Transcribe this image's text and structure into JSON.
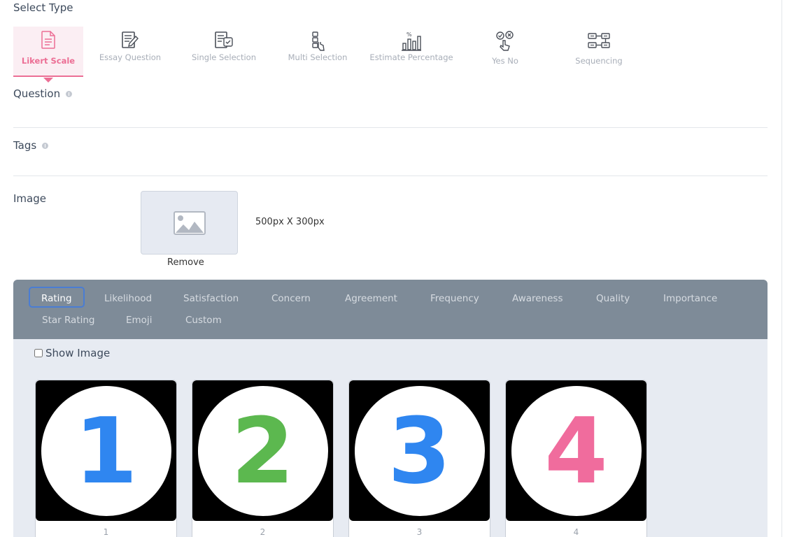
{
  "select_type": {
    "label": "Select Type",
    "items": [
      {
        "label": "Likert Scale",
        "active": true
      },
      {
        "label": "Essay Question"
      },
      {
        "label": "Single Selection"
      },
      {
        "label": "Multi Selection"
      },
      {
        "label": "Estimate Percentage"
      },
      {
        "label": "Yes No"
      },
      {
        "label": "Sequencing"
      }
    ]
  },
  "question": {
    "label": "Question"
  },
  "tags": {
    "label": "Tags"
  },
  "image": {
    "label": "Image",
    "size_hint": "500px X 300px",
    "remove_label": "Remove"
  },
  "scale_tabs": [
    "Rating",
    "Likelihood",
    "Satisfaction",
    "Concern",
    "Agreement",
    "Frequency",
    "Awareness",
    "Quality",
    "Importance",
    "Star Rating",
    "Emoji",
    "Custom"
  ],
  "active_scale_tab": "Rating",
  "show_image": {
    "label": "Show Image",
    "checked": false
  },
  "cards": [
    {
      "glyph": "1",
      "caption": "1",
      "color": "#2f86f0"
    },
    {
      "glyph": "2",
      "caption": "2",
      "color": "#5cb84f"
    },
    {
      "glyph": "3",
      "caption": "3",
      "color": "#2f86f0"
    },
    {
      "glyph": "4",
      "caption": "4",
      "color": "#f06c9d"
    }
  ],
  "colors": {
    "accent": "#ec6f95",
    "tab_bar": "#7e8b98",
    "panel_bg": "#e7ebf2",
    "active_tab_border": "#4a7dd3"
  }
}
